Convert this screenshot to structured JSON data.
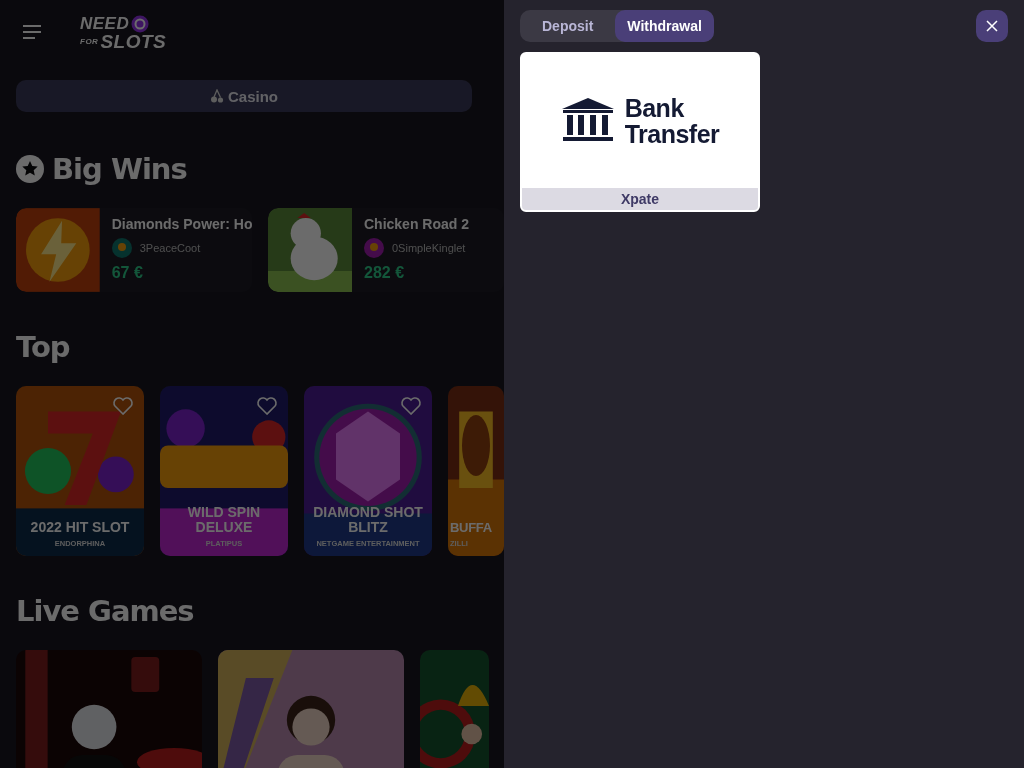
{
  "header": {
    "logo_top": "NEED",
    "logo_small": "FOR",
    "logo_bottom": "SLOTS"
  },
  "category_button": {
    "label": "Casino"
  },
  "big_wins": {
    "title": "Big Wins",
    "items": [
      {
        "game": "Diamonds Power: Ho",
        "player": "3PeaceCoot",
        "amount": "67 €"
      },
      {
        "game": "Chicken Road 2",
        "player": "0SimpleKinglet",
        "amount": "282 €"
      }
    ]
  },
  "top": {
    "title": "Top",
    "games": [
      {
        "title": "2022 HIT SLOT",
        "provider": "ENDORPHINA"
      },
      {
        "title": "WILD SPIN DELUXE",
        "provider": "PLATIPUS"
      },
      {
        "title": "DIAMOND SHOT BLITZ",
        "provider": "NETGAME ENTERTAINMENT"
      },
      {
        "title": "BUFFA",
        "provider": "ZILLI"
      }
    ]
  },
  "live_games": {
    "title": "Live Games"
  },
  "panel": {
    "tabs": [
      {
        "label": "Deposit",
        "selected": false
      },
      {
        "label": "Withdrawal",
        "selected": true
      }
    ],
    "methods": [
      {
        "logo_line_1": "Bank",
        "logo_line_2": "Transfer",
        "provider": "Xpate"
      }
    ]
  }
}
